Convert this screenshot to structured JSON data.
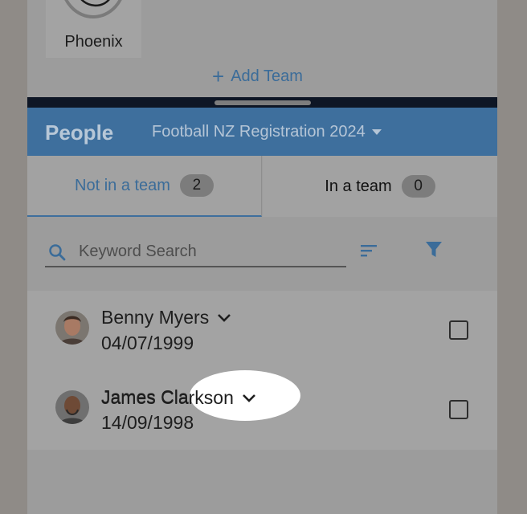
{
  "team": {
    "name": "Phoenix"
  },
  "add_team": {
    "label": "Add Team"
  },
  "header": {
    "title": "People",
    "season": "Football NZ Registration 2024"
  },
  "tabs": [
    {
      "label": "Not in a team",
      "count": "2",
      "active": true
    },
    {
      "label": "In a team",
      "count": "0",
      "active": false
    }
  ],
  "search": {
    "placeholder": "Keyword Search",
    "value": ""
  },
  "people": [
    {
      "name": "Benny Myers",
      "dob": "04/07/1999",
      "avatar": "person-photo",
      "checked": false
    },
    {
      "name": "James Clarkson",
      "dob": "14/09/1998",
      "avatar": "person-photo",
      "checked": false
    }
  ],
  "colors": {
    "accent": "#3e6f9d",
    "link": "#3b6c99",
    "overlay": "#9c9c9c"
  }
}
